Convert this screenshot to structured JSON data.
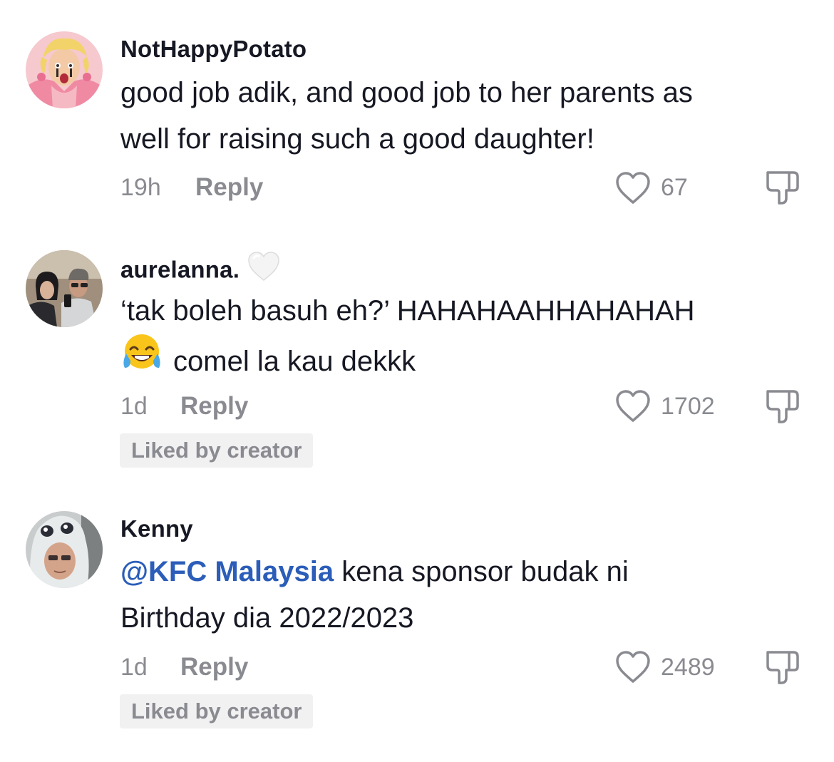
{
  "comments": [
    {
      "username": "NotHappyPotato",
      "text_line1": "good job adik, and good job to her parents as",
      "text_line2": "well for raising such a good daughter!",
      "time": "19h",
      "reply_label": "Reply",
      "likes": "67",
      "avatar_icon": "cartoon-avatar-icon"
    },
    {
      "username": "aurelanna.",
      "username_badge_icon": "white-heart-icon",
      "text_line1": "‘tak boleh basuh eh?’ HAHAHAAHHAHAHAH",
      "text_line2": "comel la kau dekkk",
      "text_emoji_icon": "tears-of-joy-emoji-icon",
      "time": "1d",
      "reply_label": "Reply",
      "likes": "1702",
      "badge": "Liked by creator",
      "avatar_icon": "photo-avatar-icon"
    },
    {
      "username": "Kenny",
      "mention": "@KFC Malaysia",
      "text_line1_rest": " kena sponsor budak ni",
      "text_line2": "Birthday dia 2022/2023",
      "time": "1d",
      "reply_label": "Reply",
      "likes": "2489",
      "badge": "Liked by creator",
      "avatar_icon": "hooded-avatar-icon"
    }
  ],
  "colors": {
    "primary_text": "#161823",
    "secondary_text": "#8a8b91",
    "mention": "#2b5db9",
    "badge_bg": "#f1f1f2"
  },
  "icons": {
    "like": "heart-outline-icon",
    "dislike": "thumbs-down-icon"
  }
}
